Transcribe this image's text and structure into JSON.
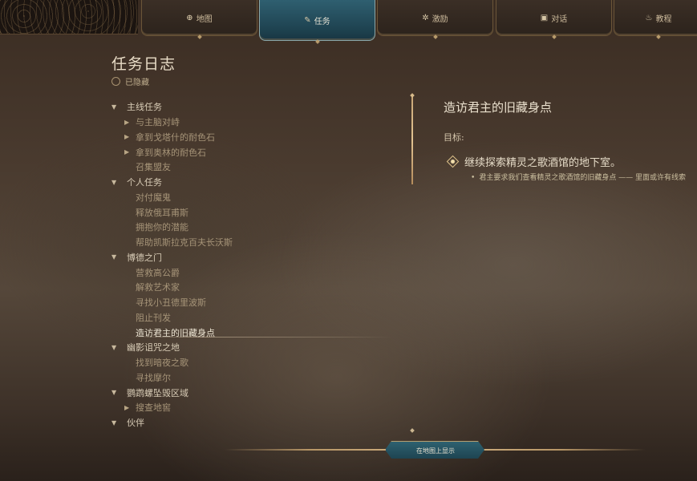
{
  "tabs": [
    {
      "label": "地图",
      "icon": "globe-icon",
      "glyph": "⊕",
      "active": false
    },
    {
      "label": "任务",
      "icon": "quill-icon",
      "glyph": "✎",
      "active": true
    },
    {
      "label": "激励",
      "icon": "sparkle-icon",
      "glyph": "✲",
      "active": false
    },
    {
      "label": "对话",
      "icon": "book-icon",
      "glyph": "▣",
      "active": false
    },
    {
      "label": "教程",
      "icon": "flame-icon",
      "glyph": "♨",
      "active": false
    }
  ],
  "journal": {
    "title": "任务日志",
    "hidden_label": "已隐藏"
  },
  "quest_tree": [
    {
      "type": "cat",
      "label": "主线任务",
      "expanded": true
    },
    {
      "type": "item",
      "label": "与主脑对峙",
      "arrow": true
    },
    {
      "type": "item",
      "label": "拿到戈塔什的耐色石",
      "arrow": true
    },
    {
      "type": "item",
      "label": "拿到奥林的耐色石",
      "arrow": true
    },
    {
      "type": "item",
      "label": "召集盟友",
      "arrow": false
    },
    {
      "type": "cat",
      "label": "个人任务",
      "expanded": true
    },
    {
      "type": "item",
      "label": "对付魔鬼",
      "arrow": false
    },
    {
      "type": "item",
      "label": "释放俄耳甫斯",
      "arrow": false
    },
    {
      "type": "item",
      "label": "拥抱你的潜能",
      "arrow": false
    },
    {
      "type": "item",
      "label": "帮助凯斯拉克百夫长沃斯",
      "arrow": false
    },
    {
      "type": "cat",
      "label": "博德之门",
      "expanded": true
    },
    {
      "type": "item",
      "label": "营救高公爵",
      "arrow": false
    },
    {
      "type": "item",
      "label": "解救艺术家",
      "arrow": false
    },
    {
      "type": "item",
      "label": "寻找小丑德里波斯",
      "arrow": false
    },
    {
      "type": "item",
      "label": "阻止刊发",
      "arrow": false
    },
    {
      "type": "item",
      "label": "造访君主的旧藏身点",
      "arrow": false,
      "selected": true
    },
    {
      "type": "cat",
      "label": "幽影诅咒之地",
      "expanded": true
    },
    {
      "type": "item",
      "label": "找到暗夜之歌",
      "arrow": false
    },
    {
      "type": "item",
      "label": "寻找摩尔",
      "arrow": false
    },
    {
      "type": "cat",
      "label": "鹦鹉螺坠毁区域",
      "expanded": true
    },
    {
      "type": "item",
      "label": "搜查地窖",
      "arrow": true
    },
    {
      "type": "cat",
      "label": "伙伴",
      "expanded": true
    }
  ],
  "detail": {
    "quest_name": "造访君主的旧藏身点",
    "objectives_label": "目标:",
    "objective": "继续探索精灵之歌酒馆的地下室。",
    "sub_objective": "君主要求我们查看精灵之歌酒馆的旧藏身点 —— 里面或许有线索"
  },
  "map_button": "在地图上显示"
}
